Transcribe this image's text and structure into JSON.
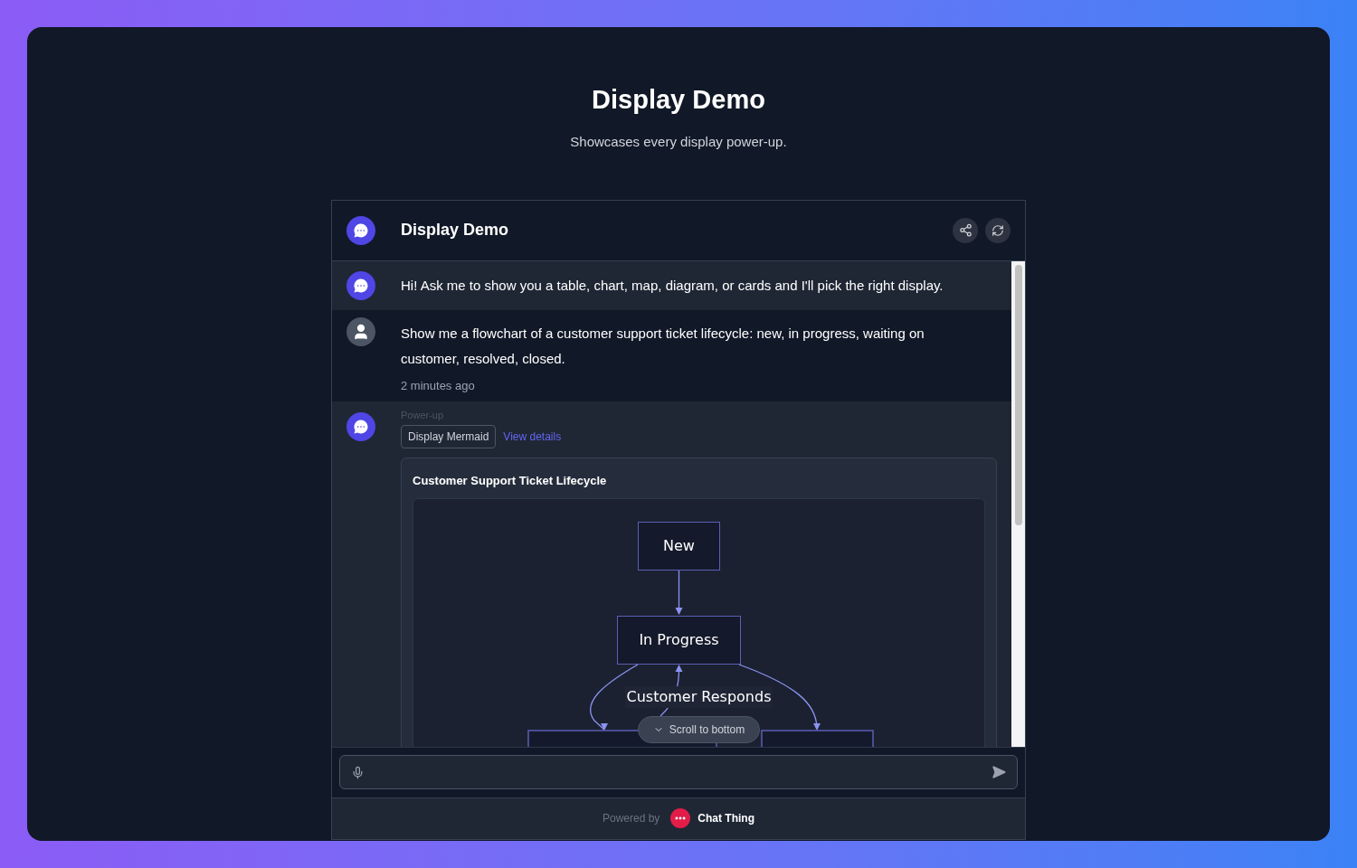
{
  "page": {
    "title": "Display Demo",
    "subtitle": "Showcases every display power-up."
  },
  "chat": {
    "title": "Display Demo",
    "messages": [
      {
        "kind": "bot",
        "text": "Hi! Ask me to show you a table, chart, map, diagram, or cards and I'll pick the right display."
      },
      {
        "kind": "user",
        "text": "Show me a flowchart of a customer support ticket lifecycle: new, in progress, waiting on customer, resolved, closed.",
        "time": "2 minutes ago"
      },
      {
        "kind": "powerup",
        "label": "Power-up",
        "tool": "Display Mermaid",
        "link": "View details",
        "card_title": "Customer Support Ticket Lifecycle",
        "nodes": [
          "New",
          "In Progress"
        ],
        "edge_label": "Customer Responds"
      }
    ],
    "scroll_button": "Scroll to bottom",
    "footer": {
      "powered_by": "Powered by",
      "brand": "Chat Thing"
    }
  }
}
